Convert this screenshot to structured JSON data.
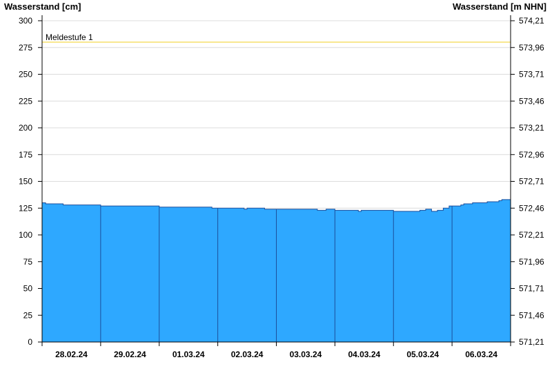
{
  "chart_data": {
    "type": "area",
    "ylabel_left": "Wasserstand [cm]",
    "ylabel_right": "Wasserstand [m NHN]",
    "ylim": [
      0,
      300
    ],
    "yticks_left": [
      0,
      25,
      50,
      75,
      100,
      125,
      150,
      175,
      200,
      225,
      250,
      275,
      300
    ],
    "yticks_right": [
      "571,21",
      "571,46",
      "571,71",
      "571,96",
      "572,21",
      "572,46",
      "572,71",
      "572,96",
      "573,21",
      "573,46",
      "573,71",
      "573,96",
      "574,21"
    ],
    "x_range": [
      "28.02.24",
      "06.03.24"
    ],
    "day_labels": [
      "28.02.24",
      "29.02.24",
      "01.03.24",
      "02.03.24",
      "03.03.24",
      "04.03.24",
      "05.03.24",
      "06.03.24"
    ],
    "grid": true,
    "fill_color": "#2ea8ff",
    "threshold": {
      "label": "Meldestufe 1",
      "value": 280,
      "color": "#f5df6a"
    },
    "series": [
      {
        "x": [
          0.0,
          0.06,
          0.35,
          0.36,
          0.95,
          1.0,
          1.5,
          1.95,
          2.0,
          2.5,
          2.8,
          2.9,
          3.0,
          3.1,
          3.4,
          3.45,
          3.5,
          3.7,
          3.8,
          3.95,
          4.0,
          4.2,
          4.6,
          4.7,
          4.85,
          4.9,
          5.0,
          5.2,
          5.4,
          5.45,
          5.5,
          5.8,
          6.0,
          6.35,
          6.45,
          6.55,
          6.65,
          6.75,
          6.85,
          6.95,
          7.0,
          7.1,
          7.15,
          7.2,
          7.35,
          7.5,
          7.6,
          7.7,
          7.8,
          7.85,
          8.0
        ],
        "values": [
          130,
          129,
          129,
          128,
          128,
          127,
          127,
          127,
          126,
          126,
          126,
          125,
          125,
          125,
          125,
          124,
          125,
          125,
          124,
          124,
          124,
          124,
          124,
          123,
          124,
          124,
          123,
          123,
          122,
          123,
          123,
          123,
          122,
          122,
          123,
          124,
          122,
          123,
          125,
          127,
          127,
          127,
          128,
          129,
          130,
          130,
          131,
          131,
          132,
          133,
          135
        ]
      }
    ]
  }
}
